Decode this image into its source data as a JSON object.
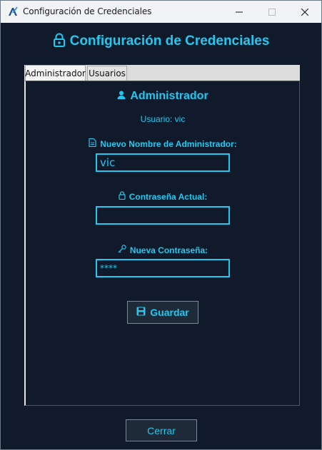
{
  "window": {
    "title": "Configuración de Credenciales",
    "controls": {
      "minimize": "–",
      "maximize": "☐",
      "close": "✕"
    }
  },
  "header": {
    "title": "Configuración de Credenciales",
    "icon": "lock-icon"
  },
  "tabs": [
    {
      "label": "Administrador",
      "active": true
    },
    {
      "label": "Usuarios",
      "active": false
    }
  ],
  "admin_panel": {
    "section_title": "Administrador",
    "user_line": "Usuario: vic",
    "fields": [
      {
        "label": "Nuevo Nombre de Administrador:",
        "icon": "document-icon",
        "value": "vic"
      },
      {
        "label": "Contraseña Actual:",
        "icon": "lock-icon",
        "value": ""
      },
      {
        "label": "Nueva Contraseña:",
        "icon": "key-icon",
        "value": "****"
      }
    ],
    "save_label": "Guardar"
  },
  "footer": {
    "close_label": "Cerrar"
  },
  "colors": {
    "accent": "#22c8f0",
    "background": "#101a2a",
    "button_bg": "#1f2a38"
  }
}
